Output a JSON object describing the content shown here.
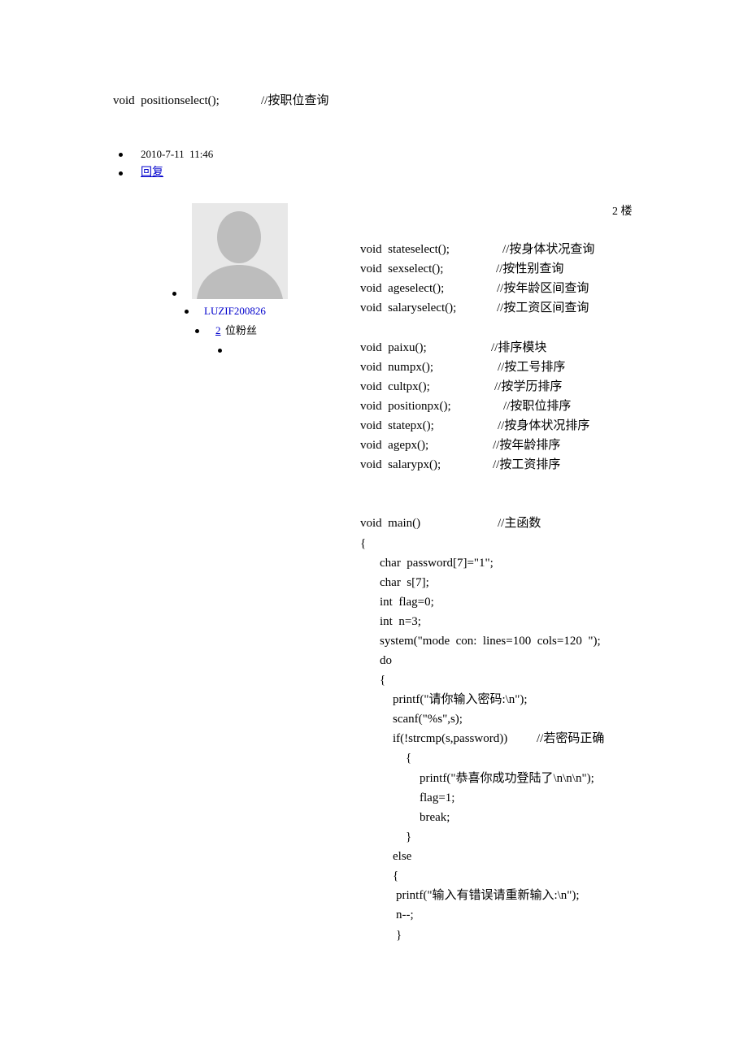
{
  "top_line": {
    "code": "void  positionselect();",
    "comment": "//按职位查询"
  },
  "post_meta": {
    "date": "2010-7-11  11:46",
    "reply_label": "回复"
  },
  "floor_label": "2 楼",
  "user": {
    "name": "LUZIF200826",
    "fans_count": "2",
    "fans_label": "位粉丝"
  },
  "code_blocks": {
    "decls1": [
      {
        "code": "void  stateselect();",
        "comment": "//按身体状况查询"
      },
      {
        "code": "void  sexselect();",
        "comment": "//按性别查询"
      },
      {
        "code": "void  ageselect();",
        "comment": "//按年龄区间查询"
      },
      {
        "code": "void  salaryselect();",
        "comment": "//按工资区间查询"
      }
    ],
    "decls2": [
      {
        "code": "void  paixu();",
        "comment": "//排序模块"
      },
      {
        "code": "void  numpx();",
        "comment": "//按工号排序"
      },
      {
        "code": "void  cultpx();",
        "comment": "//按学历排序"
      },
      {
        "code": "void  positionpx();",
        "comment": "//按职位排序"
      },
      {
        "code": "void  statepx();",
        "comment": "//按身体状况排序"
      },
      {
        "code": "void  agepx();",
        "comment": "//按年龄排序"
      },
      {
        "code": "void  salarypx();",
        "comment": "//按工资排序"
      }
    ],
    "main_head": {
      "code": "void  main()",
      "comment": "//主函数"
    },
    "main_body": [
      "{",
      "char  password[7]=\"1\";",
      "char  s[7];",
      "int  flag=0;",
      "int  n=3;",
      "system(\"mode  con:  lines=100  cols=120  \");",
      "do",
      "{",
      "printf(\"请你输入密码:\\n\");",
      "scanf(\"%s\",s);",
      "if(!strcmp(s,password))",
      "{",
      "printf(\"恭喜你成功登陆了\\n\\n\\n\");",
      "flag=1;",
      "break;",
      "}",
      "else",
      "{",
      "printf(\"输入有错误请重新输入:\\n\");",
      "n--;",
      "}"
    ],
    "if_comment": "//若密码正确"
  }
}
